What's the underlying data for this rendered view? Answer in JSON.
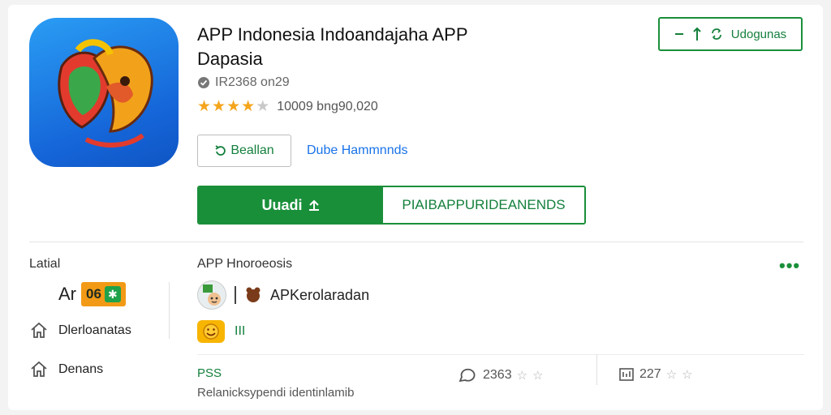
{
  "app": {
    "title_line1": "APP Indonesia Indoandajaha APP",
    "title_line2": "Dapasia",
    "id_text": "IR2368 on29",
    "rating_stars": 3.5,
    "rating_text": "10009 bng90,020"
  },
  "buttons": {
    "outline_label": "Beallan",
    "link_label": "Dube Hammnnds",
    "install_label": "Uuadi",
    "secondary_label": "PIAIBAPPURIDEANENDS",
    "top_right_label": "Udogunas"
  },
  "details": {
    "left_label": "Latial",
    "rating_letters": "Ar",
    "rating_badge": "06",
    "side_items": [
      "Dlerloanatas",
      "Denans"
    ],
    "section_title": "APP Hnoroeosis",
    "developer": "APKerolaradan",
    "emoji_label": "III",
    "pss_label": "PSS",
    "bottom_text": "Relanicksypendi identinlamib",
    "stat1": "2363",
    "stat2": "227"
  },
  "colors": {
    "accent_green": "#1a8f3a",
    "link_blue": "#1a73e8",
    "star_gold": "#f4a51c",
    "icon_blue": "#1565d8"
  },
  "icons": [
    "app-logo",
    "verified-icon",
    "refresh-icon",
    "arrow-up-icon",
    "minus-icon",
    "home-icon",
    "comment-icon",
    "grid-icon",
    "more-icon"
  ]
}
